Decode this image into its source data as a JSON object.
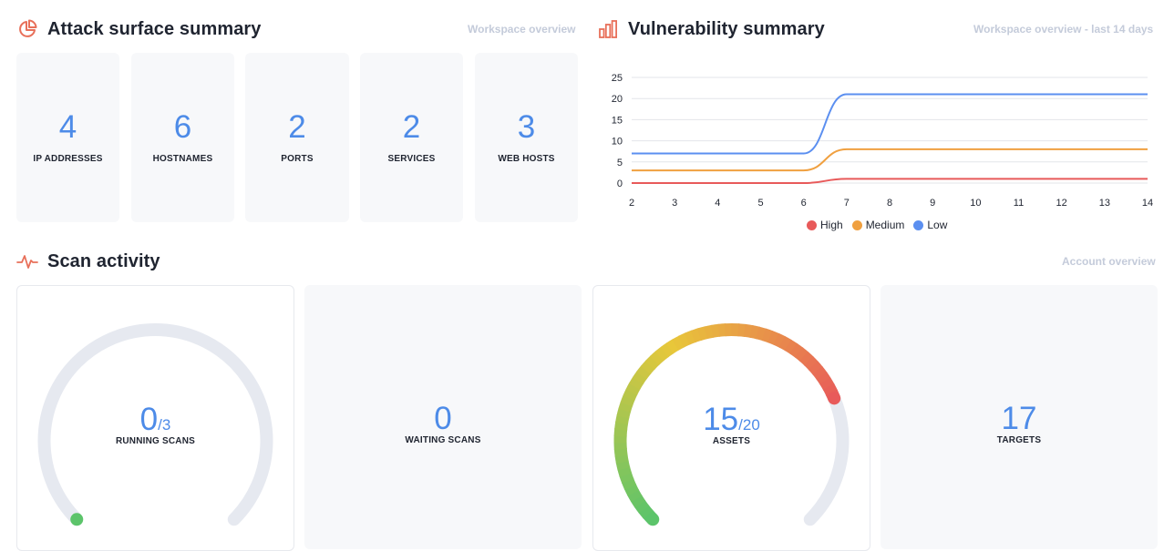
{
  "attack_surface": {
    "title": "Attack surface summary",
    "subtitle": "Workspace overview",
    "icon": "pie-chart-icon",
    "tiles": [
      {
        "value": "4",
        "label": "IP ADDRESSES"
      },
      {
        "value": "6",
        "label": "HOSTNAMES"
      },
      {
        "value": "2",
        "label": "PORTS"
      },
      {
        "value": "2",
        "label": "SERVICES"
      },
      {
        "value": "3",
        "label": "WEB HOSTS"
      }
    ]
  },
  "vulnerability": {
    "title": "Vulnerability summary",
    "subtitle": "Workspace overview - last 14 days",
    "icon": "bar-chart-icon"
  },
  "chart_data": {
    "type": "line",
    "x": [
      2,
      3,
      4,
      5,
      6,
      7,
      8,
      9,
      10,
      11,
      12,
      13,
      14
    ],
    "ylim": [
      0,
      25
    ],
    "yticks": [
      0,
      5,
      10,
      15,
      20,
      25
    ],
    "grid": true,
    "legend": "bottom",
    "series": [
      {
        "name": "High",
        "color": "#e85a5a",
        "values": [
          0,
          0,
          0,
          0,
          0,
          1,
          1,
          1,
          1,
          1,
          1,
          1,
          1
        ]
      },
      {
        "name": "Medium",
        "color": "#f0a040",
        "values": [
          3,
          3,
          3,
          3,
          3,
          8,
          8,
          8,
          8,
          8,
          8,
          8,
          8
        ]
      },
      {
        "name": "Low",
        "color": "#5b8ff0",
        "values": [
          7,
          7,
          7,
          7,
          7,
          21,
          21,
          21,
          21,
          21,
          21,
          21,
          21
        ]
      }
    ]
  },
  "scan_activity": {
    "title": "Scan activity",
    "subtitle": "Account overview",
    "icon": "activity-pulse-icon",
    "running": {
      "value": "0",
      "total": "/3",
      "label": "RUNNING SCANS",
      "fraction": 0
    },
    "waiting": {
      "value": "0",
      "label": "WAITING SCANS"
    },
    "assets": {
      "value": "15",
      "total": "/20",
      "label": "ASSETS",
      "fraction": 0.75
    },
    "targets": {
      "value": "17",
      "label": "TARGETS"
    }
  },
  "colors": {
    "accent_blue": "#4d8be8",
    "icon_red": "#e8705a",
    "gauge_track": "#e6e9f0",
    "gauge_green": "#5cc46a",
    "gauge_yellow": "#e8c73a",
    "gauge_red": "#e85a5a"
  }
}
